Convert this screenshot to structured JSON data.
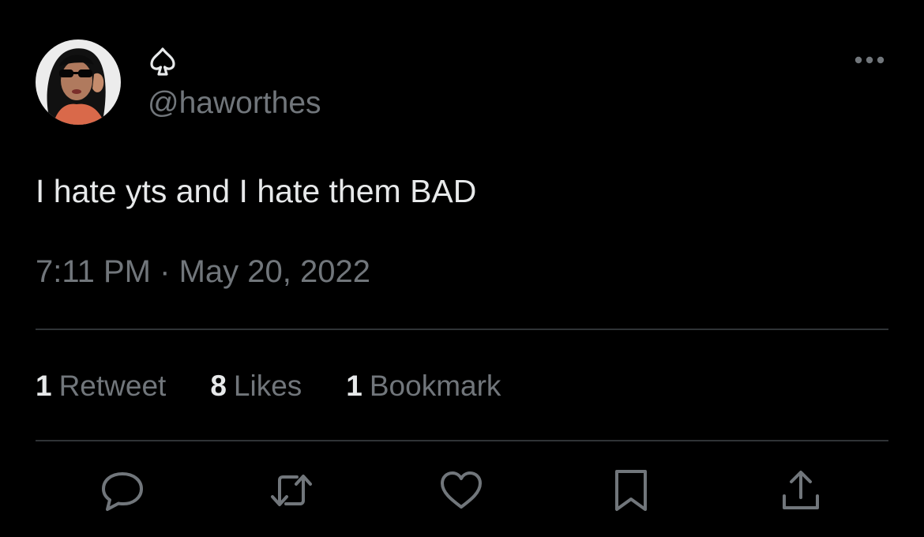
{
  "tweet": {
    "handle": "@haworthes",
    "text": "I hate yts and I hate them BAD",
    "time": "7:11 PM",
    "separator": "·",
    "date": "May 20, 2022"
  },
  "stats": [
    {
      "count": "1",
      "label": "Retweet"
    },
    {
      "count": "8",
      "label": "Likes"
    },
    {
      "count": "1",
      "label": "Bookmark"
    }
  ],
  "colors": {
    "background": "#000000",
    "text_primary": "#e7e9ea",
    "text_secondary": "#71767b",
    "divider": "#2f3336"
  },
  "icons": {
    "display_name": "spade-icon",
    "more": "more-dots-icon",
    "actions": [
      "reply-icon",
      "retweet-icon",
      "like-icon",
      "bookmark-icon",
      "share-icon"
    ]
  }
}
